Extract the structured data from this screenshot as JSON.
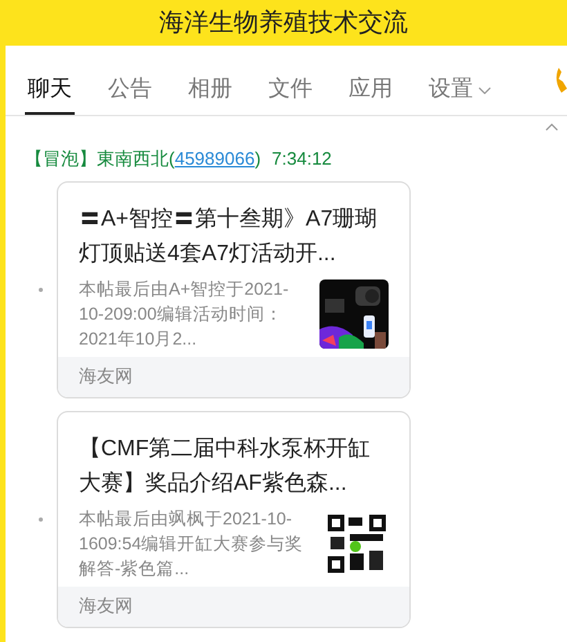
{
  "window": {
    "title": "海洋生物养殖技术交流"
  },
  "tabs": [
    {
      "label": "聊天",
      "selected": true
    },
    {
      "label": "公告",
      "selected": false
    },
    {
      "label": "相册",
      "selected": false
    },
    {
      "label": "文件",
      "selected": false
    },
    {
      "label": "应用",
      "selected": false
    },
    {
      "label": "设置",
      "selected": false,
      "dropdown": true
    }
  ],
  "message": {
    "badge": "【冒泡】",
    "sender": "東南西北(",
    "qq": "45989066",
    "sender_end": ")",
    "time": "7:34:12",
    "cards": [
      {
        "title": "〓A+智控〓第十叁期》A7珊瑚灯顶贴送4套A7灯活动开...",
        "summary": "本帖最后由A+智控于2021-10-209:00编辑活动时间：2021年10月2...",
        "source": "海友网"
      },
      {
        "title": "【CMF第二届中科水泵杯开缸大赛】奖品介绍AF紫色森...",
        "summary": "本帖最后由飒枫于2021-10-1609:54编辑开缸大赛参与奖解答-紫色篇...",
        "source": "海友网",
        "kind": "qr"
      }
    ]
  }
}
